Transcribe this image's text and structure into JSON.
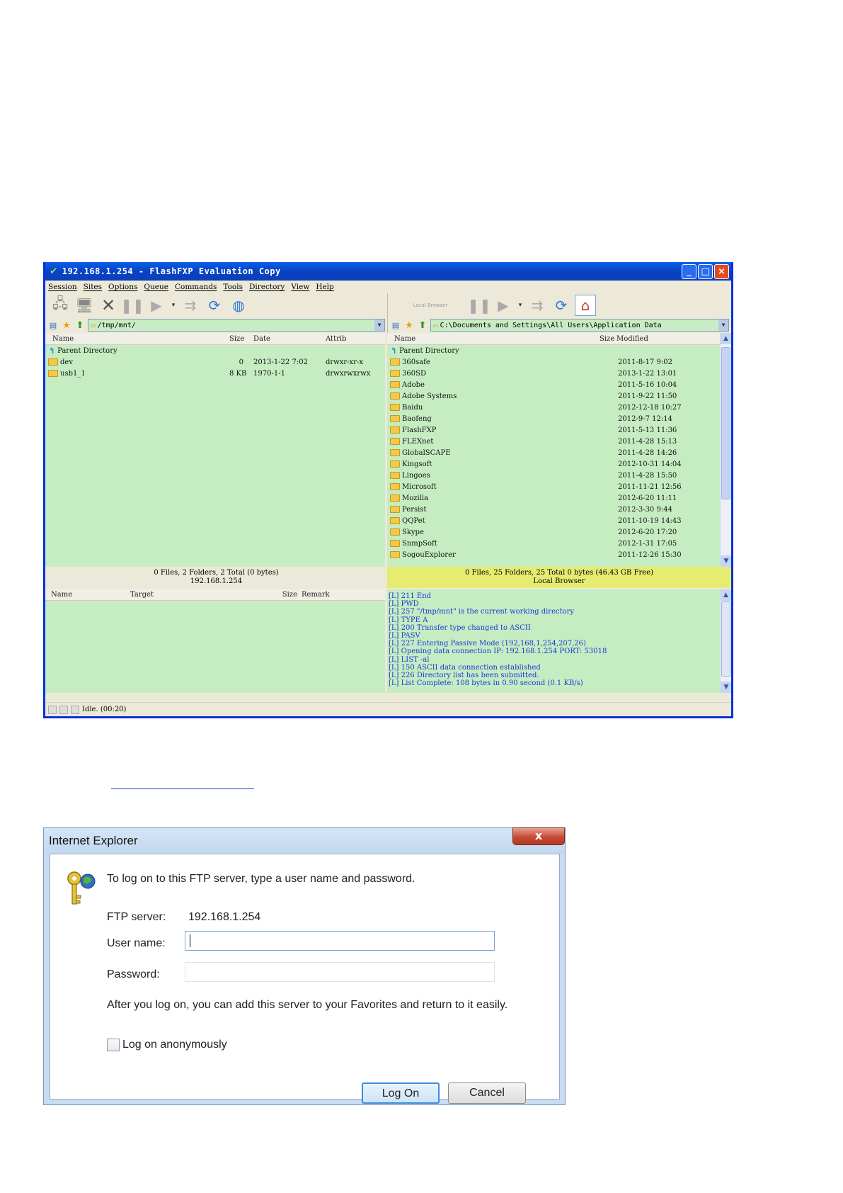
{
  "fxp": {
    "title": "192.168.1.254 - FlashFXP Evaluation Copy",
    "window_buttons": {
      "minimize": "_",
      "maximize": "□",
      "close": "×"
    },
    "menu": [
      "Session",
      "Sites",
      "Options",
      "Queue",
      "Commands",
      "Tools",
      "Directory",
      "View",
      "Help"
    ],
    "local_browser_button": "Local Browser",
    "left": {
      "path": "/tmp/mnt/",
      "columns": {
        "name": "Name",
        "size": "Size",
        "date": "Date",
        "attrib": "Attrib"
      },
      "parent": "Parent Directory",
      "rows": [
        {
          "name": "dev",
          "size": "0",
          "date": "2013-1-22 7:02",
          "attrib": "drwxr-xr-x"
        },
        {
          "name": "usb1_1",
          "size": "8 KB",
          "date": "1970-1-1",
          "attrib": "drwxrwxrwx"
        }
      ],
      "status_line1": "0 Files, 2 Folders, 2 Total (0 bytes)",
      "status_line2": "192.168.1.254"
    },
    "right": {
      "path": "C:\\Documents and Settings\\All Users\\Application Data",
      "columns": {
        "name": "Name",
        "size": "Size",
        "modified": "Modified"
      },
      "parent": "Parent Directory",
      "rows": [
        {
          "name": "360safe",
          "modified": "2011-8-17 9:02"
        },
        {
          "name": "360SD",
          "modified": "2013-1-22 13:01"
        },
        {
          "name": "Adobe",
          "modified": "2011-5-16 10:04"
        },
        {
          "name": "Adobe Systems",
          "modified": "2011-9-22 11:50"
        },
        {
          "name": "Baidu",
          "modified": "2012-12-18 10:27"
        },
        {
          "name": "Baofeng",
          "modified": "2012-9-7 12:14"
        },
        {
          "name": "FlashFXP",
          "modified": "2011-5-13 11:36"
        },
        {
          "name": "FLEXnet",
          "modified": "2011-4-28 15:13"
        },
        {
          "name": "GlobalSCAPE",
          "modified": "2011-4-28 14:26"
        },
        {
          "name": "Kingsoft",
          "modified": "2012-10-31 14:04"
        },
        {
          "name": "Lingoes",
          "modified": "2011-4-28 15:50"
        },
        {
          "name": "Microsoft",
          "modified": "2011-11-21 12:56"
        },
        {
          "name": "Mozilla",
          "modified": "2012-6-20 11:11"
        },
        {
          "name": "Persist",
          "modified": "2012-3-30 9:44"
        },
        {
          "name": "QQPet",
          "modified": "2011-10-19 14:43"
        },
        {
          "name": "Skype",
          "modified": "2012-6-20 17:20"
        },
        {
          "name": "SnmpSoft",
          "modified": "2012-1-31 17:05"
        },
        {
          "name": "SogouExplorer",
          "modified": "2011-12-26 15:30"
        }
      ],
      "status_line1": "0 Files, 25 Folders, 25 Total 0 bytes (46.43 GB Free)",
      "status_line2": "Local Browser"
    },
    "queue_columns": {
      "name": "Name",
      "target": "Target",
      "size": "Size",
      "remark": "Remark"
    },
    "log": [
      "[L] 211 End",
      "[L] PWD",
      "[L] 257 \"/tmp/mnt\" is the current working directory",
      "[L] TYPE A",
      "[L] 200 Transfer type changed to ASCII",
      "[L] PASV",
      "[L] 227 Entering Passive Mode (192,168,1,254,207,26)",
      "[L] Opening data connection IP: 192.168.1.254 PORT: 53018",
      "[L] LIST -al",
      "[L] 150 ASCII data connection established",
      "[L] 226 Directory list has been submitted.",
      "[L] List Complete: 108 bytes in 0.90 second (0.1 KB/s)"
    ],
    "statusbar": "Idle. (00:20)"
  },
  "ie": {
    "title": "Internet Explorer",
    "close_glyph": "x",
    "prompt": "To log on to this FTP server, type a user name and password.",
    "server_label": "FTP server:",
    "server_value": "192.168.1.254",
    "user_label": "User name:",
    "user_value": "",
    "password_label": "Password:",
    "password_value": "",
    "note": "After you log on, you can add this server to your Favorites and return to it easily.",
    "anonymous_label": "Log on anonymously",
    "anonymous_checked": false,
    "logon_button": "Log On",
    "cancel_button": "Cancel"
  }
}
